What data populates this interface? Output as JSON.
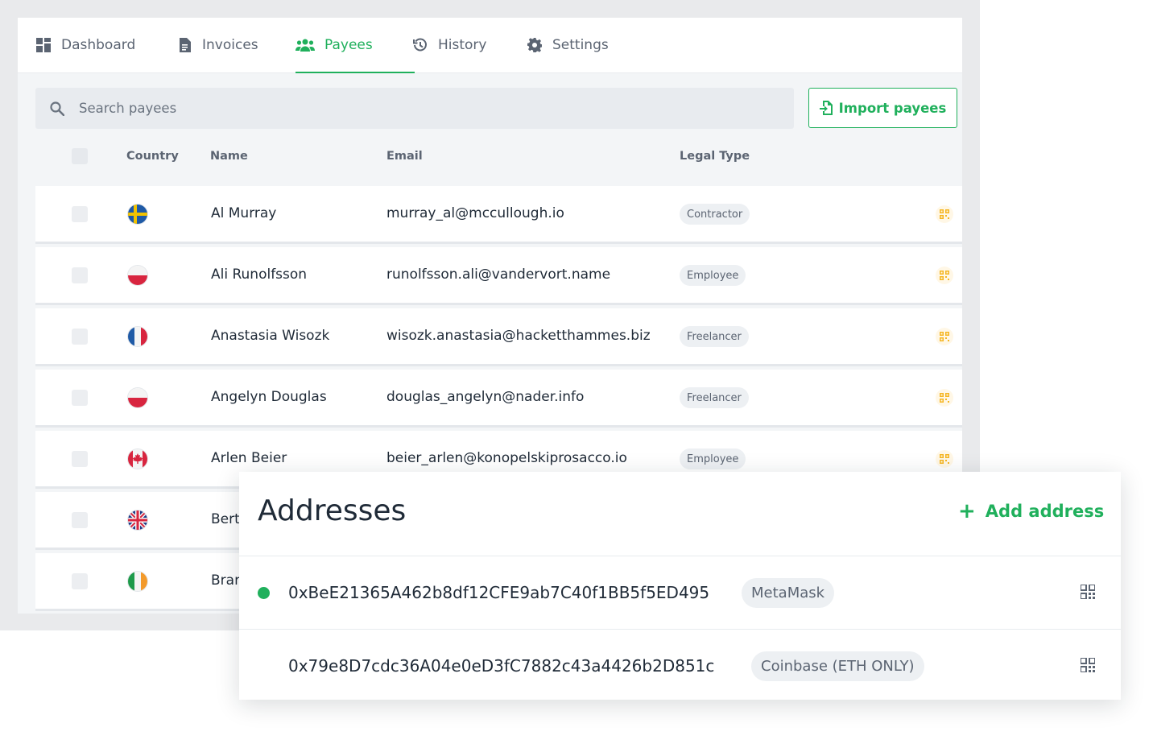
{
  "nav": {
    "tabs": [
      {
        "label": "Dashboard",
        "icon": "dashboard-icon"
      },
      {
        "label": "Invoices",
        "icon": "invoice-icon"
      },
      {
        "label": "Payees",
        "icon": "users-icon",
        "active": true
      },
      {
        "label": "History",
        "icon": "history-icon"
      },
      {
        "label": "Settings",
        "icon": "gear-icon"
      }
    ]
  },
  "search": {
    "placeholder": "Search payees"
  },
  "import_button": {
    "label": "Import payees"
  },
  "table": {
    "headers": {
      "country": "Country",
      "name": "Name",
      "email": "Email",
      "legal_type": "Legal Type"
    },
    "rows": [
      {
        "country_flag": "sweden-flag",
        "name": "Al Murray",
        "email": "murray_al@mccullough.io",
        "legal_type": "Contractor"
      },
      {
        "country_flag": "poland-flag",
        "name": "Ali Runolfsson",
        "email": "runolfsson.ali@vandervort.name",
        "legal_type": "Employee"
      },
      {
        "country_flag": "france-flag",
        "name": "Anastasia Wisozk",
        "email": "wisozk.anastasia@hacketthammes.biz",
        "legal_type": "Freelancer"
      },
      {
        "country_flag": "poland-flag",
        "name": "Angelyn Douglas",
        "email": "douglas_angelyn@nader.info",
        "legal_type": "Freelancer"
      },
      {
        "country_flag": "canada-flag",
        "name": "Arlen Beier",
        "email": "beier_arlen@konopelskiprosacco.io",
        "legal_type": "Employee"
      },
      {
        "country_flag": "uk-flag",
        "name": "Bert",
        "email": "",
        "legal_type": ""
      },
      {
        "country_flag": "ireland-flag",
        "name": "Brar",
        "email": "",
        "legal_type": ""
      }
    ]
  },
  "addresses": {
    "title": "Addresses",
    "add_label": "Add address",
    "items": [
      {
        "address": "0xBeE21365A462b8df12CFE9ab7C40f1BB5f5ED495",
        "wallet": "MetaMask",
        "active": true
      },
      {
        "address": "0x79e8D7cdc36A04e0eD3fC7882c43a4426b2D851c",
        "wallet": "Coinbase (ETH ONLY)",
        "active": false
      }
    ]
  },
  "colors": {
    "accent": "#20b05c",
    "qr_accent": "#f5b623"
  }
}
